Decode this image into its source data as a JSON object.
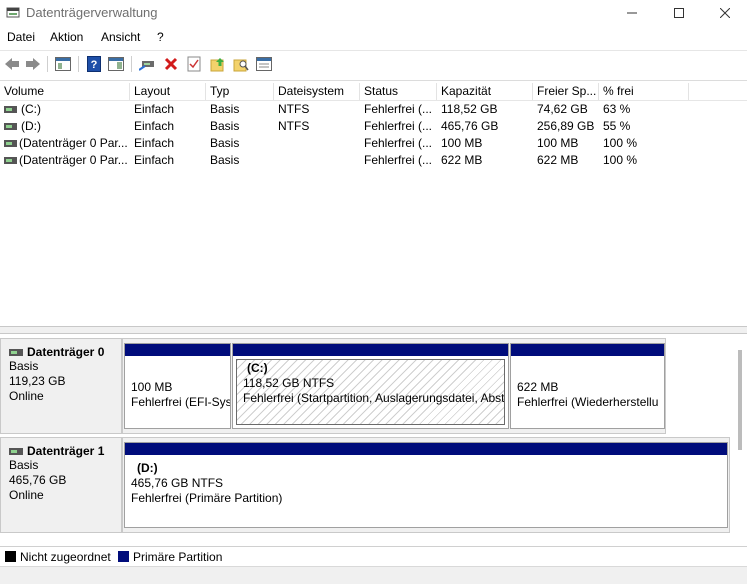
{
  "window": {
    "title": "Datenträgerverwaltung"
  },
  "menu": {
    "items": [
      "Datei",
      "Aktion",
      "Ansicht",
      "?"
    ]
  },
  "toolbar": {
    "icons": [
      "back-arrow-icon",
      "forward-arrow-icon",
      "console-tree-icon",
      "help-icon",
      "properties-pane-icon",
      "connect-disk-icon",
      "delete-icon",
      "checklist-icon",
      "folder-up-icon",
      "folder-search-icon",
      "properties-icon"
    ]
  },
  "volume_table": {
    "headers": [
      "Volume",
      "Layout",
      "Typ",
      "Dateisystem",
      "Status",
      "Kapazität",
      "Freier Sp...",
      "% frei"
    ],
    "rows": [
      [
        "(C:)",
        "Einfach",
        "Basis",
        "NTFS",
        "Fehlerfrei (...",
        "118,52 GB",
        "74,62 GB",
        "63 %"
      ],
      [
        "(D:)",
        "Einfach",
        "Basis",
        "NTFS",
        "Fehlerfrei (...",
        "465,76 GB",
        "256,89 GB",
        "55 %"
      ],
      [
        "(Datenträger 0 Par...",
        "Einfach",
        "Basis",
        "",
        "Fehlerfrei (...",
        "100 MB",
        "100 MB",
        "100 %"
      ],
      [
        "(Datenträger 0 Par...",
        "Einfach",
        "Basis",
        "",
        "Fehlerfrei (...",
        "622 MB",
        "622 MB",
        "100 %"
      ]
    ]
  },
  "disks": [
    {
      "name": "Datenträger 0",
      "type": "Basis",
      "size": "119,23 GB",
      "state": "Online",
      "partitions": [
        {
          "title": "",
          "size": "100 MB",
          "status": "Fehlerfrei (EFI-Sys"
        },
        {
          "title": "(C:)",
          "size": "118,52 GB NTFS",
          "status": "Fehlerfrei (Startpartition, Auslagerungsdatei, Abstu"
        },
        {
          "title": "",
          "size": "622 MB",
          "status": "Fehlerfrei (Wiederherstellu"
        }
      ]
    },
    {
      "name": "Datenträger 1",
      "type": "Basis",
      "size": "465,76 GB",
      "state": "Online",
      "partitions": [
        {
          "title": "(D:)",
          "size": "465,76 GB NTFS",
          "status": "Fehlerfrei (Primäre Partition)"
        }
      ]
    }
  ],
  "legend": {
    "items": [
      {
        "label": "Nicht zugeordnet",
        "color": "#000000"
      },
      {
        "label": "Primäre Partition",
        "color": "#000c7b"
      }
    ]
  },
  "colors": {
    "partition_bar": "#000c7b",
    "panel_bg": "#f0f0f0"
  }
}
